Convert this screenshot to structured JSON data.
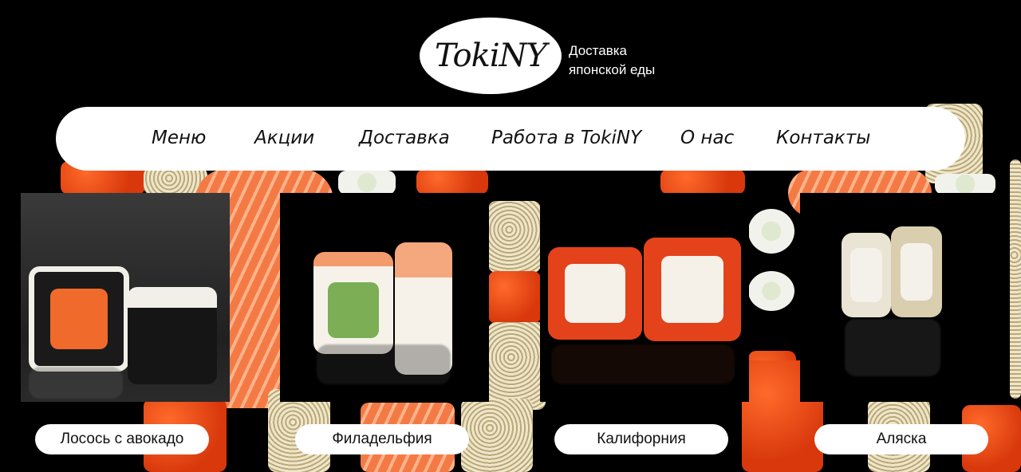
{
  "brand": {
    "logo_text": "TokiNY",
    "tagline_line1": "Доставка",
    "tagline_line2": "японской еды"
  },
  "nav": {
    "items": [
      {
        "label": "Меню"
      },
      {
        "label": "Акции"
      },
      {
        "label": "Доставка"
      },
      {
        "label": "Работа в TokiNY"
      },
      {
        "label": "О нас"
      },
      {
        "label": "Контакты"
      }
    ]
  },
  "products": [
    {
      "name": "Лосось с авокадо"
    },
    {
      "name": "Филадельфия"
    },
    {
      "name": "Калифорния"
    },
    {
      "name": "Аляска"
    }
  ],
  "colors": {
    "background": "#000000",
    "pill": "#ffffff",
    "text": "#111111",
    "accent_tobiko": "#e0461a"
  }
}
